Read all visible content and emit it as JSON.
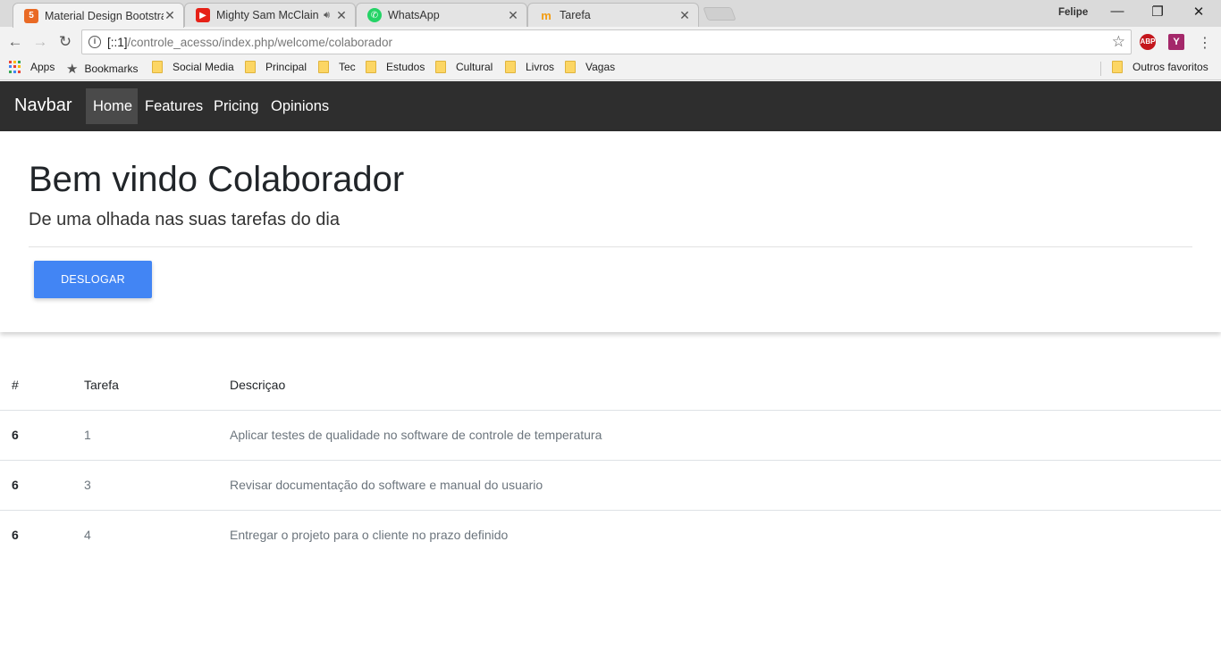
{
  "browser": {
    "tabs": [
      {
        "title": "Material Design Bootstra",
        "favicon": "html5-icon",
        "color": "#e96a25"
      },
      {
        "title": "Mighty Sam McClain",
        "favicon": "youtube-icon",
        "color": "#e62117"
      },
      {
        "title": "WhatsApp",
        "favicon": "whatsapp-icon",
        "color": "#25d366"
      },
      {
        "title": "Tarefa",
        "favicon": "m-icon",
        "color": "#f39c12"
      }
    ],
    "profile": "Felipe",
    "url_prefix": "[::1]",
    "url_rest": "/controle_acesso/index.php/welcome/colaborador",
    "bookmarks": [
      "Apps",
      "Bookmarks",
      "Social Media",
      "Principal",
      "Tec",
      "Estudos",
      "Cultural",
      "Livros",
      "Vagas"
    ],
    "other_bookmarks": "Outros favoritos",
    "extensions": {
      "adblock": "ABP",
      "yoast": "Y"
    }
  },
  "navbar": {
    "brand": "Navbar",
    "items": [
      {
        "label": "Home",
        "active": true
      },
      {
        "label": "Features"
      },
      {
        "label": "Pricing"
      },
      {
        "label": "Opinions"
      }
    ]
  },
  "jumbotron": {
    "title": "Bem vindo Colaborador",
    "lead": "De uma olhada nas suas tarefas do dia",
    "button": "DESLOGAR"
  },
  "table": {
    "headers": [
      "#",
      "Tarefa",
      "Descriçao"
    ],
    "rows": [
      [
        "6",
        "1",
        "Aplicar testes de qualidade no software de controle de temperatura"
      ],
      [
        "6",
        "3",
        "Revisar documentação do software e manual do usuario"
      ],
      [
        "6",
        "4",
        "Entregar o projeto para o cliente no prazo definido"
      ]
    ]
  },
  "colors": {
    "navbar_bg": "#2e2e2e",
    "button_bg": "#4285f4"
  }
}
